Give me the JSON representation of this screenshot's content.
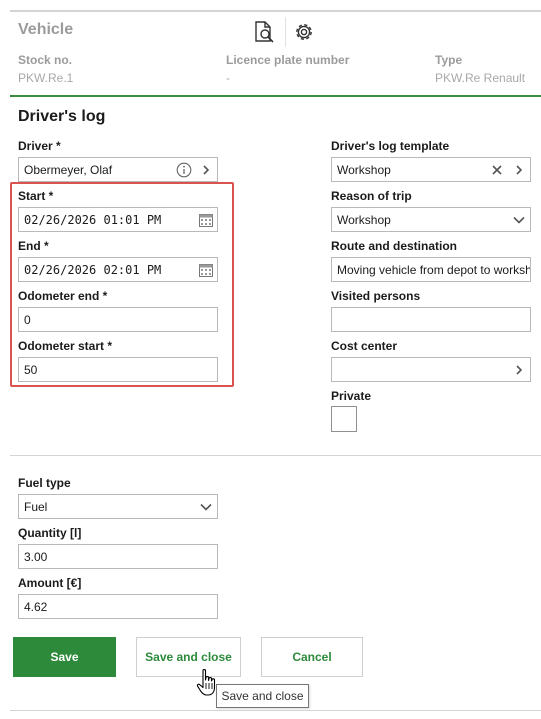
{
  "vehicle": {
    "title": "Vehicle",
    "stock_no": {
      "label": "Stock no.",
      "value": "PKW.Re.1"
    },
    "licence_plate": {
      "label": "Licence plate number",
      "value": "-"
    },
    "type": {
      "label": "Type",
      "value": "PKW.Re Renault"
    }
  },
  "drivers_log": {
    "title": "Driver's log",
    "driver": {
      "label": "Driver *",
      "value": "Obermeyer, Olaf"
    },
    "start": {
      "label": "Start *",
      "value": "02/26/2026 01:01 PM"
    },
    "end": {
      "label": "End *",
      "value": "02/26/2026 02:01 PM"
    },
    "odometer_end": {
      "label": "Odometer end *",
      "value": "0"
    },
    "odometer_start": {
      "label": "Odometer start *",
      "value": "50"
    },
    "template": {
      "label": "Driver's log template",
      "value": "Workshop"
    },
    "reason": {
      "label": "Reason of trip",
      "value": "Workshop"
    },
    "route": {
      "label": "Route and destination",
      "value": "Moving vehicle from depot to workshop"
    },
    "visited": {
      "label": "Visited persons",
      "value": ""
    },
    "cost_center": {
      "label": "Cost center",
      "value": ""
    },
    "private": {
      "label": "Private",
      "checked": false
    }
  },
  "fuel": {
    "fuel_type": {
      "label": "Fuel type",
      "value": "Fuel"
    },
    "quantity": {
      "label": "Quantity [l]",
      "value": "3.00"
    },
    "amount": {
      "label": "Amount [€]",
      "value": "4.62"
    }
  },
  "buttons": {
    "save": "Save",
    "save_close": "Save and close",
    "cancel": "Cancel"
  },
  "tooltip": "Save and close",
  "icons": {
    "preview": "document-search-icon",
    "settings": "gear-icon",
    "info": "info-icon",
    "chevron_right": "chevron-right-icon",
    "chevron_down": "chevron-down-icon",
    "clear": "close-icon",
    "calendar": "calendar-icon",
    "cursor": "hand-pointer-icon"
  },
  "colors": {
    "accent": "#2d8a3b",
    "highlight": "#d9534f"
  }
}
